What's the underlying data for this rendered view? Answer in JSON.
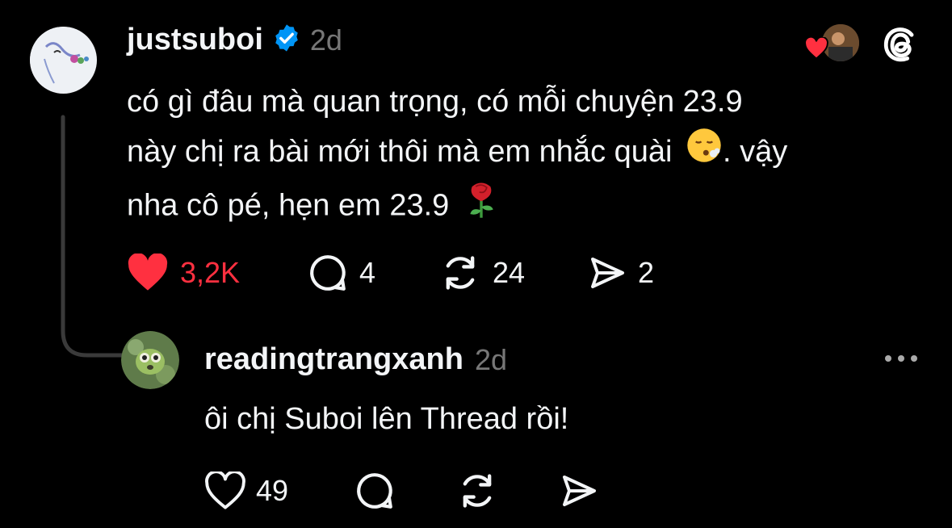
{
  "post": {
    "username": "justsuboi",
    "verified": true,
    "time": "2d",
    "text_line1": "có gì đâu mà quan trọng, có mỗi chuyện 23.9",
    "text_line2a": "này chị ra bài mới thôi mà em nhắc quài",
    "text_line2b": ". vậy",
    "text_line3": "nha cô pé, hẹn em 23.9",
    "like_count": "3,2K",
    "reply_count": "4",
    "repost_count": "24",
    "share_count": "2",
    "liked": true,
    "like_color": "#ff3040"
  },
  "reply": {
    "username": "readingtrangxanh",
    "time": "2d",
    "text": "ôi chị Suboi lên Thread rồi!",
    "like_count": "49"
  },
  "icons": {
    "verified": "verified-badge-icon",
    "threads_logo": "threads-logo-icon",
    "like": "heart-icon",
    "reply": "comment-icon",
    "repost": "repost-icon",
    "share": "send-icon",
    "more": "more-options-icon"
  }
}
